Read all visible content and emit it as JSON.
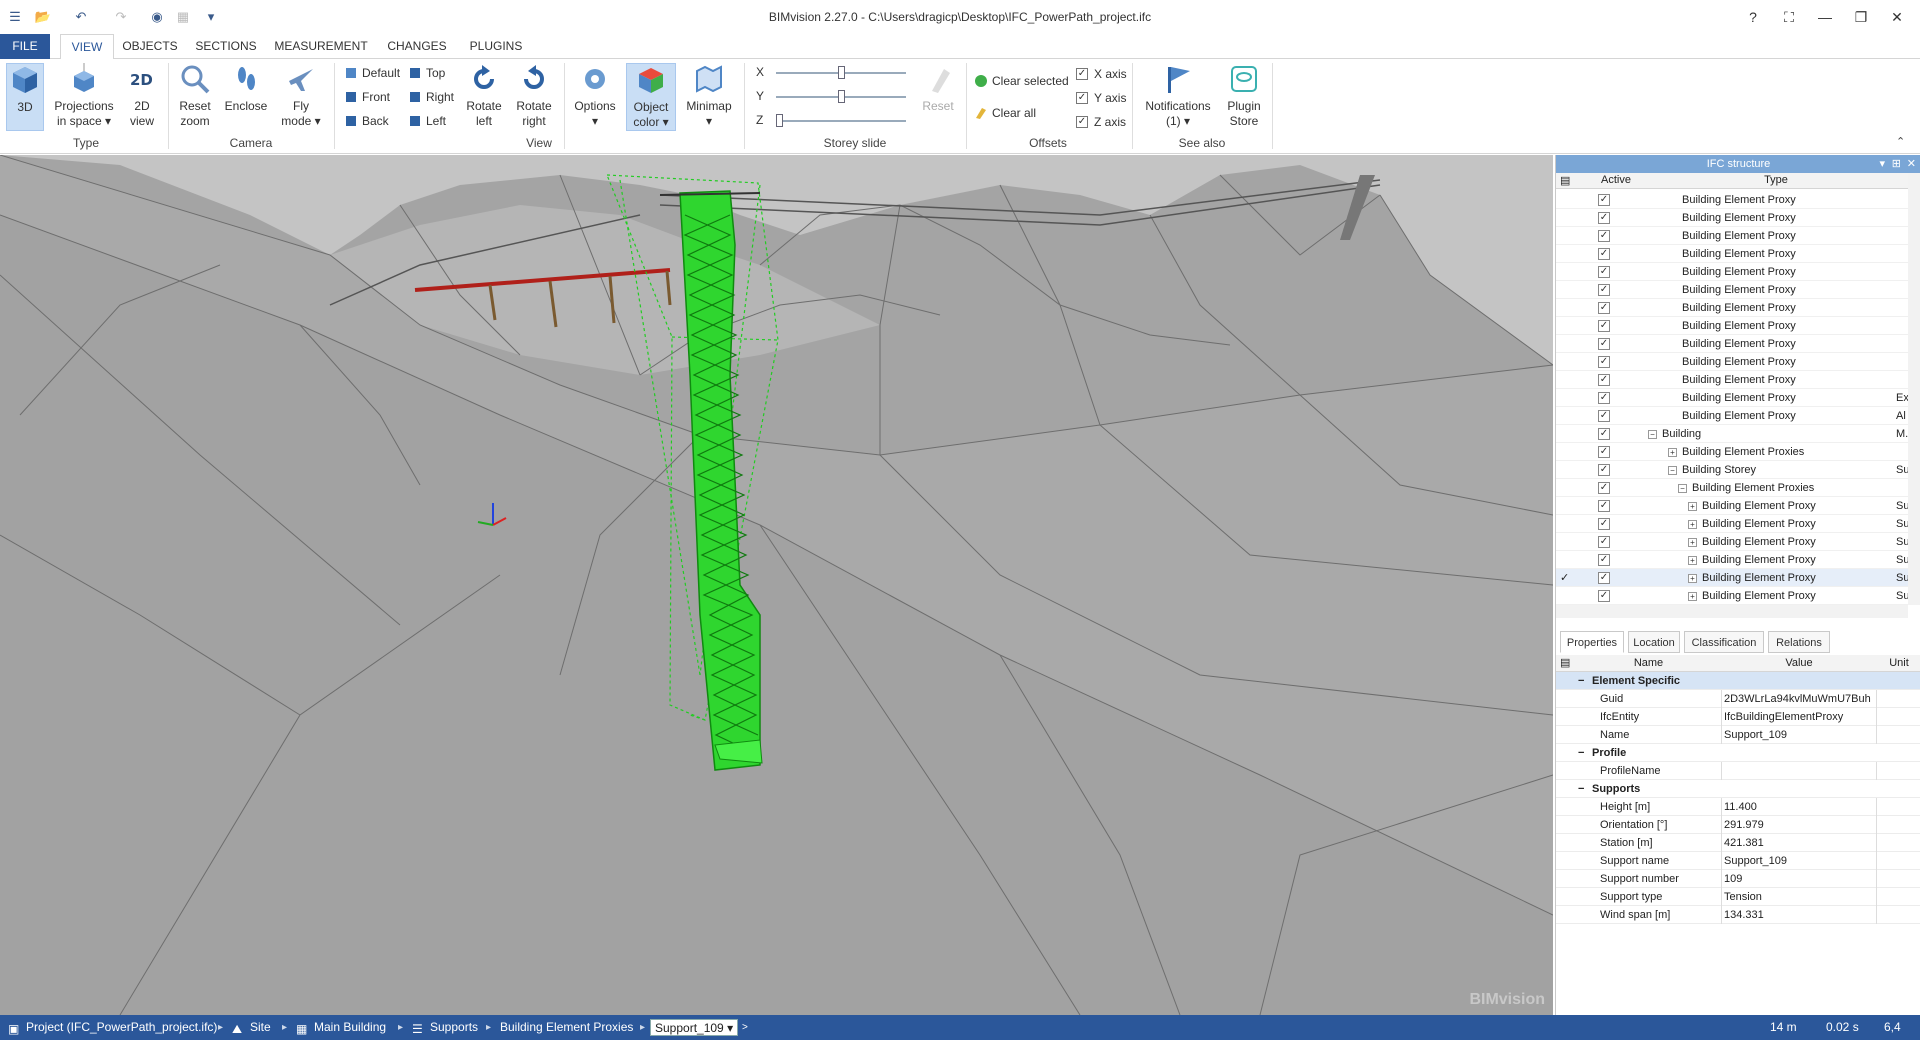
{
  "window": {
    "title": "BIMvision 2.27.0 - C:\\Users\\dragicp\\Desktop\\IFC_PowerPath_project.ifc",
    "help": "?",
    "buttons": [
      "?",
      "⛶",
      "—",
      "❐",
      "✕"
    ]
  },
  "tabs": [
    "FILE",
    "VIEW",
    "OBJECTS",
    "SECTIONS",
    "MEASUREMENT",
    "CHANGES",
    "PLUGINS"
  ],
  "active_tab": "VIEW",
  "ribbon": {
    "type_group": {
      "label": "Type",
      "btn_3d": "3D",
      "projections_1": "Projections",
      "projections_2": "in space",
      "view2d_1": "2D",
      "view2d_2": "view"
    },
    "camera_group": {
      "label": "Camera",
      "reset_zoom_1": "Reset",
      "reset_zoom_2": "zoom",
      "enclose": "Enclose",
      "fly_1": "Fly",
      "fly_2": "mode"
    },
    "view_group": {
      "label": "View",
      "default": "Default",
      "front": "Front",
      "back": "Back",
      "top": "Top",
      "right": "Right",
      "left": "Left",
      "rotate_left_1": "Rotate",
      "rotate_left_2": "left",
      "rotate_right_1": "Rotate",
      "rotate_right_2": "right",
      "options": "Options",
      "object_color_1": "Object",
      "object_color_2": "color",
      "minimap": "Minimap"
    },
    "storey_group": {
      "label": "Storey slide",
      "x": "X",
      "y": "Y",
      "z": "Z",
      "x_level": 0.5,
      "y_level": 0.5,
      "z_level": 0.0,
      "reset": "Reset"
    },
    "offsets_group": {
      "label": "Offsets",
      "clear_selected": "Clear selected",
      "clear_all": "Clear all",
      "x_axis": "X axis",
      "y_axis": "Y axis",
      "z_axis": "Z axis",
      "x_checked": "✓",
      "y_checked": "✓",
      "z_checked": "✓"
    },
    "see_also_group": {
      "label": "See also",
      "notifications_1": "Notifications",
      "notifications_2": "(1)",
      "plugin_1": "Plugin",
      "plugin_2": "Store"
    }
  },
  "viewport": {
    "watermark": "BIMvision",
    "highlight_color": "#22dd22",
    "terrain_color": "#a9a9a9"
  },
  "ifc_structure": {
    "title": "IFC structure",
    "col_active": "Active",
    "col_type": "Type",
    "check": "✓",
    "rows": [
      {
        "label": "Building Element Proxy",
        "extra": ""
      },
      {
        "label": "Building Element Proxy",
        "extra": ""
      },
      {
        "label": "Building Element Proxy",
        "extra": ""
      },
      {
        "label": "Building Element Proxy",
        "extra": ""
      },
      {
        "label": "Building Element Proxy",
        "extra": ""
      },
      {
        "label": "Building Element Proxy",
        "extra": ""
      },
      {
        "label": "Building Element Proxy",
        "extra": ""
      },
      {
        "label": "Building Element Proxy",
        "extra": ""
      },
      {
        "label": "Building Element Proxy",
        "extra": ""
      },
      {
        "label": "Building Element Proxy",
        "extra": ""
      },
      {
        "label": "Building Element Proxy",
        "extra": ""
      },
      {
        "label": "Building Element Proxy",
        "extra": "Ex"
      },
      {
        "label": "Building Element Proxy",
        "extra": "Al"
      },
      {
        "label": "Building",
        "extra": "M."
      },
      {
        "label": "Building Element Proxies",
        "extra": ""
      },
      {
        "label": "Building Storey",
        "extra": "Su"
      },
      {
        "label": "Building Element Proxies",
        "extra": ""
      },
      {
        "label": "Building Element Proxy",
        "extra": "Su"
      },
      {
        "label": "Building Element Proxy",
        "extra": "Su"
      },
      {
        "label": "Building Element Proxy",
        "extra": "Su"
      },
      {
        "label": "Building Element Proxy",
        "extra": "Su"
      },
      {
        "label": "Building Element Proxy",
        "extra": "Su"
      },
      {
        "label": "Building Element Proxy",
        "extra": "Su"
      }
    ]
  },
  "property_tabs": [
    "Properties",
    "Location",
    "Classification",
    "Relations"
  ],
  "properties": {
    "col_name": "Name",
    "col_value": "Value",
    "col_unit": "Unit",
    "cat_element": "Element Specific",
    "guid_name": "Guid",
    "guid_value": "2D3WLrLa94kvlMuWmU7Buh",
    "ifc_name": "IfcEntity",
    "ifc_value": "IfcBuildingElementProxy",
    "name_name": "Name",
    "name_value": "Support_109",
    "cat_profile": "Profile",
    "profile_name": "ProfileName",
    "profile_value": "",
    "cat_supports": "Supports",
    "height_name": "Height [m]",
    "height_value": "11.400",
    "orient_name": "Orientation [°]",
    "orient_value": "291.979",
    "station_name": "Station [m]",
    "station_value": "421.381",
    "sname_name": "Support name",
    "sname_value": "Support_109",
    "snum_name": "Support number",
    "snum_value": "109",
    "stype_name": "Support type",
    "stype_value": "Tension",
    "wind_name": "Wind span [m]",
    "wind_value": "134.331",
    "collapse": "−"
  },
  "statusbar": {
    "project": "Project (IFC_PowerPath_project.ifc)",
    "site": "Site",
    "building": "Main Building",
    "supports": "Supports",
    "proxies": "Building Element Proxies",
    "current": "Support_109",
    "distance": "14 m",
    "time": "0.02 s",
    "fps": "6,4"
  }
}
